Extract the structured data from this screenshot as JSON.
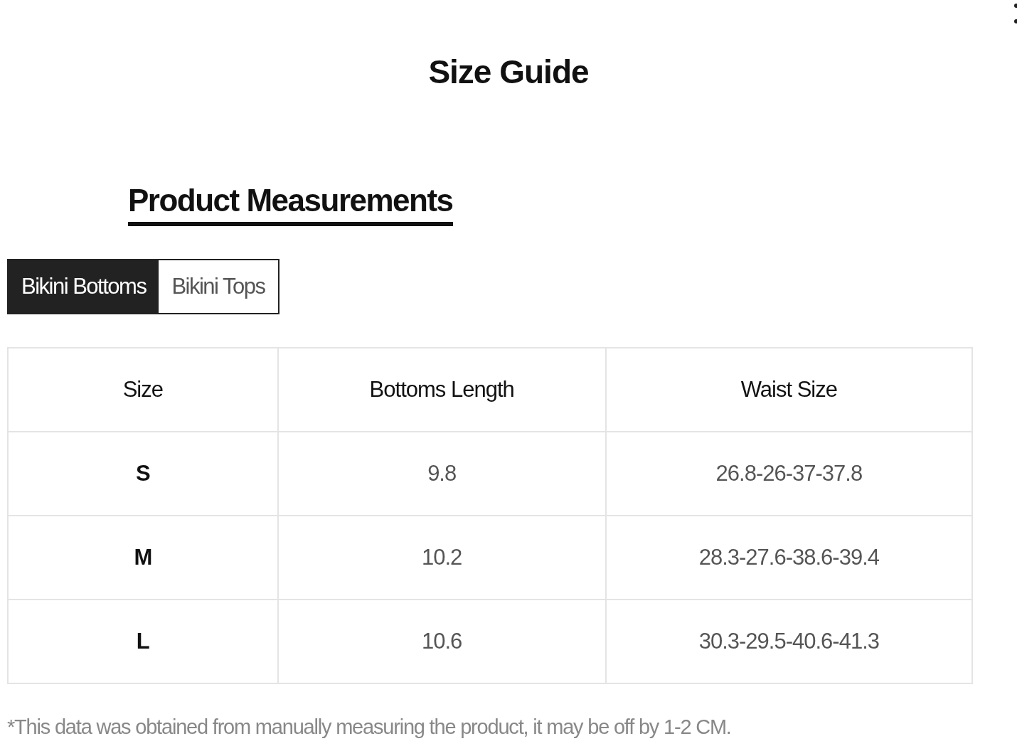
{
  "title": "Size Guide",
  "section_heading": "Product Measurements",
  "tabs": [
    {
      "label": "Bikini Bottoms",
      "selected": true
    },
    {
      "label": "Bikini Tops",
      "selected": false
    }
  ],
  "table": {
    "columns": [
      "Size",
      "Bottoms Length",
      "Waist Size"
    ],
    "rows": [
      [
        "S",
        "9.8",
        "26.8-26-37-37.8"
      ],
      [
        "M",
        "10.2",
        "28.3-27.6-38.6-39.4"
      ],
      [
        "L",
        "10.6",
        "30.3-29.5-40.6-41.3"
      ]
    ]
  },
  "footnote": "*This data was obtained from manually measuring the product, it may be off by 1-2 CM."
}
